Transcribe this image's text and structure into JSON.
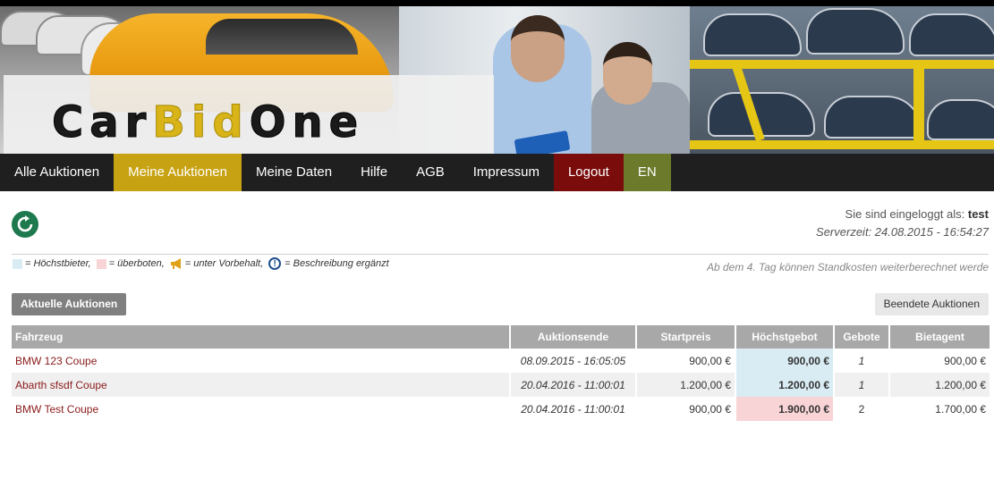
{
  "brand": {
    "logo_text_1": "Car",
    "logo_text_2": "Bid",
    "logo_text_3": "One"
  },
  "nav": {
    "items": [
      {
        "label": "Alle Auktionen"
      },
      {
        "label": "Meine Auktionen"
      },
      {
        "label": "Meine Daten"
      },
      {
        "label": "Hilfe"
      },
      {
        "label": "AGB"
      },
      {
        "label": "Impressum"
      },
      {
        "label": "Logout"
      },
      {
        "label": "EN"
      }
    ]
  },
  "session": {
    "logged_in_prefix": "Sie sind eingeloggt als:",
    "username": "test",
    "servertime": "Serverzeit: 24.08.2015 - 16:54:27"
  },
  "legend": {
    "highest_bidder": "= Höchstbieter,",
    "outbid": "= überboten,",
    "reserve": "= unter Vorbehalt,",
    "description_added": "= Beschreibung ergänzt"
  },
  "ticker": "Ab dem 4. Tag können Standkosten weiterberechnet werden",
  "buttons": {
    "current": "Aktuelle Auktionen",
    "ended": "Beendete Auktionen"
  },
  "table": {
    "headers": {
      "vehicle": "Fahrzeug",
      "end": "Auktionsende",
      "start_price": "Startpreis",
      "highest_bid": "Höchstgebot",
      "bids": "Gebote",
      "bid_agent": "Bietagent"
    },
    "rows": [
      {
        "vehicle": "BMW 123 Coupe",
        "end": "08.09.2015 - 16:05:05",
        "start_price": "900,00 €",
        "highest_bid": "900,00 €",
        "bids": "1",
        "bid_agent": "900,00 €",
        "status": "highest"
      },
      {
        "vehicle": "Abarth sfsdf Coupe",
        "end": "20.04.2016 - 11:00:01",
        "start_price": "1.200,00 €",
        "highest_bid": "1.200,00 €",
        "bids": "1",
        "bid_agent": "1.200,00 €",
        "status": "highest"
      },
      {
        "vehicle": "BMW Test Coupe",
        "end": "20.04.2016 - 11:00:01",
        "start_price": "900,00 €",
        "highest_bid": "1.900,00 €",
        "bids": "2",
        "bid_agent": "1.700,00 €",
        "status": "outbid"
      }
    ]
  },
  "colors": {
    "highest_bidder": "#d9ecf4",
    "outbid": "#f8d4d6",
    "nav_active": "#c7a212",
    "nav_logout": "#7a0c0c",
    "nav_lang": "#6b7a2b"
  },
  "icons": {
    "refresh": "refresh-icon",
    "reserve": "megaphone-icon",
    "info": "info-icon"
  }
}
